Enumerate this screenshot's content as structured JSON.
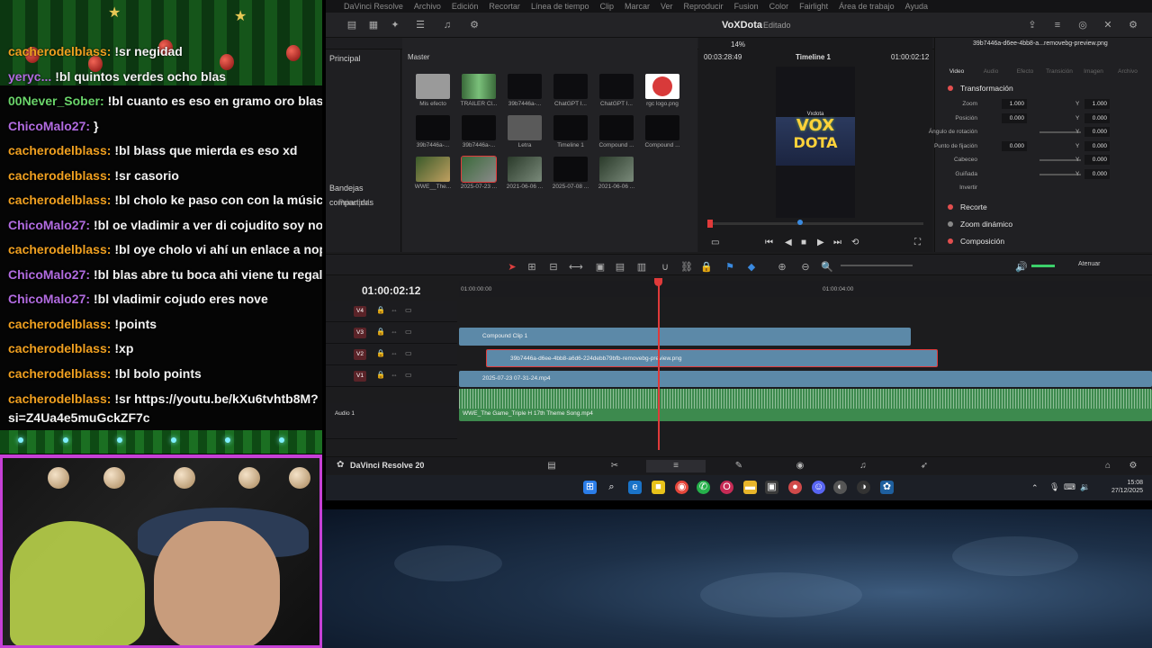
{
  "chat": {
    "messages": [
      {
        "user": "cacherodelblass:",
        "text": "!sr negidad",
        "user_color": "#f0a020"
      },
      {
        "user": "yeryc...",
        "text": "!bl quintos verdes ocho blas",
        "user_color": "#b16be0"
      },
      {
        "user": "00Never_Sober:",
        "text": "!bl cuanto es eso en gramo oro blas wano",
        "user_color": "#6ad46a"
      },
      {
        "user": "ChicoMalo27:",
        "text": "}",
        "user_color": "#b16be0"
      },
      {
        "user": "cacherodelblass:",
        "text": "!bl blass que mierda es eso xd",
        "user_color": "#f0a020"
      },
      {
        "user": "cacherodelblass:",
        "text": "!sr casorio",
        "user_color": "#f0a020"
      },
      {
        "user": "cacherodelblass:",
        "text": "!bl cholo ke paso con con la música",
        "user_color": "#f0a020"
      },
      {
        "user": "ChicoMalo27:",
        "text": "!bl oe vladimir a ver di cojudito soy nove",
        "user_color": "#b16be0"
      },
      {
        "user": "cacherodelblass:",
        "text": "!bl oye cholo vi ahí un enlace a nopor",
        "user_color": "#f0a020"
      },
      {
        "user": "ChicoMalo27:",
        "text": "!bl blas abre tu boca ahi viene tu regalo de nav",
        "user_color": "#b16be0"
      },
      {
        "user": "ChicoMalo27:",
        "text": "!bl vladimir cojudo eres nove",
        "user_color": "#b16be0"
      },
      {
        "user": "cacherodelblass:",
        "text": "!points",
        "user_color": "#f0a020"
      },
      {
        "user": "cacherodelblass:",
        "text": "!xp",
        "user_color": "#f0a020"
      },
      {
        "user": "cacherodelblass:",
        "text": "!bl bolo points",
        "user_color": "#f0a020"
      },
      {
        "user": "cacherodelblass:",
        "text": "!sr https://youtu.be/kXu6tvhtb8M?si=Z4Ua4e5muGckZF7c",
        "user_color": "#f0a020"
      }
    ]
  },
  "resolve": {
    "menu": [
      "DaVinci Resolve",
      "Archivo",
      "Edición",
      "Recortar",
      "Línea de tiempo",
      "Clip",
      "Marcar",
      "Ver",
      "Reproducir",
      "Fusion",
      "Color",
      "Fairlight",
      "Área de trabajo",
      "Ayuda"
    ],
    "project_title": "VoXDota",
    "project_status": "Editado",
    "sidebar": {
      "principal": "Principal",
      "shared": "Bandejas compartidas",
      "principal2": "Principal"
    },
    "pool": {
      "title": "Master",
      "items": [
        {
          "label": "Mis efecto",
          "kind": "folder"
        },
        {
          "label": "TRÁILER Cl...",
          "kind": "audio"
        },
        {
          "label": "39b7446a-...",
          "kind": "image"
        },
        {
          "label": "ChatGPT I...",
          "kind": "image"
        },
        {
          "label": "ChatGPT I...",
          "kind": "image"
        },
        {
          "label": "rgc logo.png",
          "kind": "logo"
        },
        {
          "label": "39b7446a-...",
          "kind": "dark"
        },
        {
          "label": "39b7446a-...",
          "kind": "dark"
        },
        {
          "label": "Letra",
          "kind": "grey"
        },
        {
          "label": "Timeline 1",
          "kind": "timeline"
        },
        {
          "label": "Compound ...",
          "kind": "dark"
        },
        {
          "label": "Compound ...",
          "kind": "dark"
        },
        {
          "label": "WWE__The...",
          "kind": "wwe"
        },
        {
          "label": "2025-07-23 ...",
          "kind": "video-sel"
        },
        {
          "label": "2021-06-06 ...",
          "kind": "video"
        },
        {
          "label": "2025-07-08 ...",
          "kind": "dark"
        },
        {
          "label": "2021-06-06 ...",
          "kind": "video"
        }
      ]
    },
    "viewer": {
      "zoom": "14%",
      "timecode_left": "00:03:28:49",
      "timeline_name": "Timeline 1",
      "timecode_right": "01:00:02:12",
      "screen_top": "Vxdota",
      "logo_line1": "VOX",
      "logo_line2": "DOTA"
    },
    "inspector": {
      "file": "39b7446a-d6ee-4bb8-a...removebg-preview.png",
      "tabs": [
        "Video",
        "Audio",
        "Efecto",
        "Transición",
        "Imagen",
        "Archivo"
      ],
      "transform_label": "Transformación",
      "params": [
        {
          "label": "Zoom",
          "x": "1.000",
          "y": "1.000"
        },
        {
          "label": "Posición",
          "x": "0.000",
          "y": "0.000"
        },
        {
          "label": "Ángulo de rotación",
          "y": "0.000"
        },
        {
          "label": "Punto de fijación",
          "x": "0.000",
          "y": "0.000"
        },
        {
          "label": "Cabeceo",
          "y": "0.000"
        },
        {
          "label": "Guiñada",
          "y": "0.000"
        },
        {
          "label": "Invertir"
        }
      ],
      "sections": [
        "Recorte",
        "Zoom dinámico",
        "Composición"
      ]
    },
    "timeline": {
      "timecode": "01:00:02:12",
      "ruler": [
        "01:00:00:00",
        "01:00:04:00"
      ],
      "attenuate": "Atenuar",
      "tracks": [
        "V4",
        "V3",
        "V2",
        "V1",
        "Audio 1"
      ],
      "clips": {
        "v3": "Compound Clip 1",
        "v2": "39b7446a-d6ee-4bb8-a6d6-224debb79bfb-removebg-preview.png",
        "v1": "2025-07-23 07-31-24.mp4",
        "a1": "WWE_The Game_Triple H 17th Theme Song.mp4"
      }
    },
    "pagebar_name": "DaVinci Resolve 20",
    "clock": {
      "time": "15:08",
      "date": "27/12/2025"
    }
  },
  "colors": {
    "accent_red": "#e23b3b",
    "clip_video": "#5c89a8",
    "clip_audio": "#3d8a4e",
    "cam_border": "#c640d6"
  }
}
